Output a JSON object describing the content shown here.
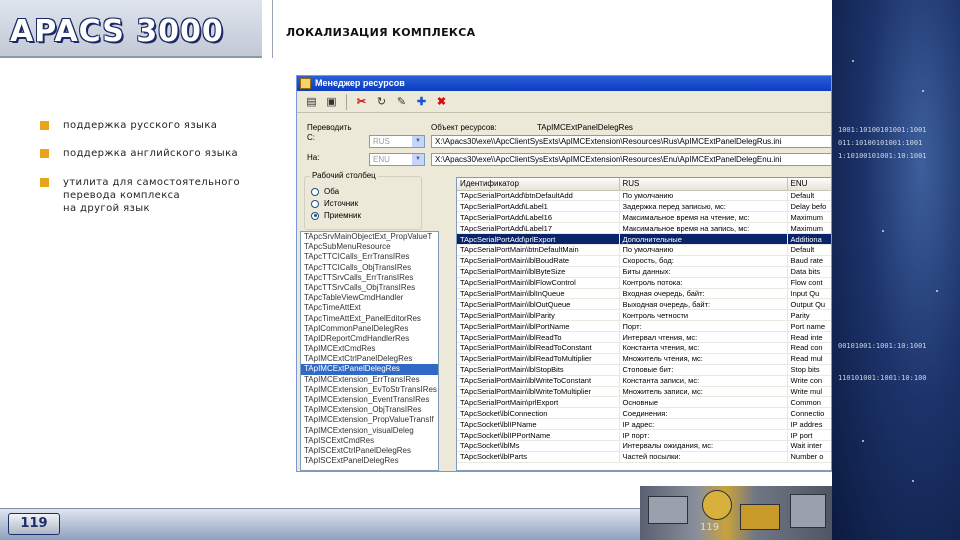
{
  "header": {
    "logo_text": "APACS 3000",
    "title": "ЛОКАЛИЗАЦИЯ КОМПЛЕКСА"
  },
  "bullets": [
    {
      "text": "поддержка русского языка"
    },
    {
      "text": "поддержка английского языка"
    },
    {
      "text": "утилита для самостоятельного\nперевода комплекса\nна другой язык"
    }
  ],
  "footer": {
    "badge": "119",
    "page": "119"
  },
  "colors": {
    "accent_bullet": "#e8a51a",
    "brand_blue": "#1d2f66",
    "selection": "#0a246a"
  },
  "app": {
    "window_title": "Менеджер ресурсов",
    "toolbar_icons": [
      "open-icon",
      "save-icon",
      "cut-icon",
      "refresh-icon",
      "edit-icon",
      "add-icon",
      "delete-icon"
    ],
    "translate_label": "Переводить",
    "from_label": "С:",
    "to_label": "На:",
    "from_lang": "RUS",
    "to_lang": "ENU",
    "resource_label": "Объект ресурсов:",
    "resource_name": "TApIMCExtPanelDelegRes",
    "from_path": "X:\\Apacs30\\exe\\\\ApcClientSysExts\\ApIMCExtension\\Resources\\Rus\\ApIMCExtPanelDelegRus.ini",
    "to_path": "X:\\Apacs30\\exe\\\\ApcClientSysExts\\ApIMCExtension\\Resources\\Enu\\ApIMCExtPanelDelegEnu.ini",
    "column_group_label": "Рабочий столбец",
    "radios": [
      {
        "label": "Оба",
        "checked": false
      },
      {
        "label": "Источник",
        "checked": false
      },
      {
        "label": "Приемник",
        "checked": true
      }
    ],
    "resource_list": [
      "TApcSrvMainObjectExt_PropValueT",
      "TApcSubMenuResource",
      "TApcTTCICalls_ErrTransIRes",
      "TApcTTCICalls_ObjTransIRes",
      "TApcTTSrvCalls_ErrTransIRes",
      "TApcTTSrvCalls_ObjTransIRes",
      "TApcTableViewCmdHandler",
      "TApcTimeAttExt",
      "TApcTimeAttExt_PanelEditorRes",
      "TApICommonPanelDelegRes",
      "TApIDReportCmdHandlerRes",
      "TApIMCExtCmdRes",
      "TApIMCExtCtrlPanelDelegRes",
      "TApIMCExtPanelDelegRes",
      "TApIMCExtension_ErrTransIRes",
      "TApIMCExtension_EvToStrTransIRes",
      "TApIMCExtension_EventTransIRes",
      "TApIMCExtension_ObjTransIRes",
      "TApIMCExtension_PropValueTransIf",
      "TApIMCExtension_visualDeleg",
      "TApISCExtCmdRes",
      "TApISCExtCtrlPanelDelegRes",
      "TApISCExtPanelDelegRes"
    ],
    "resource_list_selected": 13,
    "grid": {
      "columns": [
        "Идентификатор",
        "RUS",
        "ENU"
      ],
      "selected_row": 4,
      "rows": [
        [
          "TApcSerialPortAdd\\btnDefaultAdd",
          "По умолчанию",
          "Default"
        ],
        [
          "TApcSerialPortAdd\\Label1",
          "Задержка перед записью, мс:",
          "Delay befo"
        ],
        [
          "TApcSerialPortAdd\\Label16",
          "Максимальное время на чтение, мс:",
          "Maximum"
        ],
        [
          "TApcSerialPortAdd\\Label17",
          "Максимальное время на запись, мс:",
          "Maximum"
        ],
        [
          "TApcSerialPortAdd\\prlExport",
          "Дополнительные",
          "Additiona"
        ],
        [
          "TApcSerialPortMain\\btnDefaultMain",
          "По умолчанию",
          "Default"
        ],
        [
          "TApcSerialPortMain\\lblBoudRate",
          "Скорость, бод:",
          "Baud rate"
        ],
        [
          "TApcSerialPortMain\\lblByteSize",
          "Биты данных:",
          "Data bits"
        ],
        [
          "TApcSerialPortMain\\lblFlowControl",
          "Контроль потока:",
          "Flow cont"
        ],
        [
          "TApcSerialPortMain\\lblInQueue",
          "Входная очередь, байт:",
          "Input Qu"
        ],
        [
          "TApcSerialPortMain\\lblOutQueue",
          "Выходная очередь, байт:",
          "Output Qu"
        ],
        [
          "TApcSerialPortMain\\lblParity",
          "Контроль четности",
          "Parity"
        ],
        [
          "TApcSerialPortMain\\lblPortName",
          "Порт:",
          "Port name"
        ],
        [
          "TApcSerialPortMain\\lblReadTo",
          "Интервал чтения, мс:",
          "Read inte"
        ],
        [
          "TApcSerialPortMain\\lblReadToConstant",
          "Константа чтения, мс:",
          "Read con"
        ],
        [
          "TApcSerialPortMain\\lblReadToMultiplier",
          "Множитель чтения, мс:",
          "Read mul"
        ],
        [
          "TApcSerialPortMain\\lblStopBits",
          "Стоповые бит:",
          "Stop bits"
        ],
        [
          "TApcSerialPortMain\\lblWriteToConstant",
          "Константа записи, мс:",
          "Write con"
        ],
        [
          "TApcSerialPortMain\\lblWriteToMultiplier",
          "Множитель записи, мс:",
          "Write mul"
        ],
        [
          "TApcSerialPortMain\\prlExport",
          "Основные",
          "Common"
        ],
        [
          "TApcSocket\\lblConnection",
          "Соединения:",
          "Connectio"
        ],
        [
          "TApcSocket\\lblIPName",
          "IP адрес:",
          "IP addres"
        ],
        [
          "TApcSocket\\lblIPPortName",
          "IP порт:",
          "IP port"
        ],
        [
          "TApcSocket\\lblMs",
          "Интервалы ожидания, мс:",
          "Wait inter"
        ],
        [
          "TApcSocket\\lblParts",
          "Частей посылки:",
          "Number o"
        ]
      ]
    }
  },
  "decor_binary": [
    "1001:10100101001:1001",
    "011:10100101001:1001",
    "1:10100101001:10:1001",
    "00101001:1001:10:1001",
    "110101001:1001:10:100"
  ]
}
